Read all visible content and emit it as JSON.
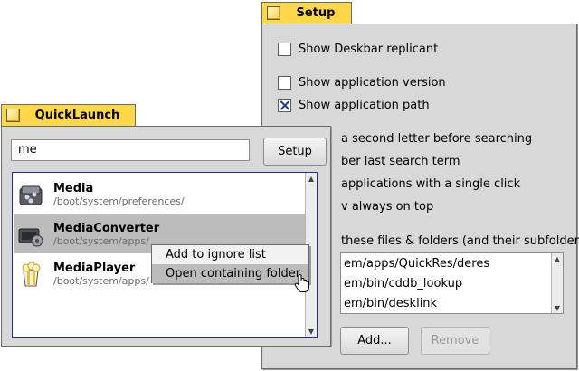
{
  "setup_window": {
    "title": "Setup",
    "options": [
      {
        "label": "Show Deskbar replicant",
        "checked": false
      },
      {
        "label": "Show application version",
        "checked": false
      },
      {
        "label": "Show application path",
        "checked": true
      },
      {
        "label": "a second letter before searching"
      },
      {
        "label": "ber last search term"
      },
      {
        "label": "applications with a single click"
      },
      {
        "label": "v always on top"
      }
    ],
    "ignore_label": "these files & folders (and their subfolders):",
    "ignore_list": [
      "em/apps/QuickRes/deres",
      "em/bin/cddb_lookup",
      "em/bin/desklink"
    ],
    "add_button": "Add...",
    "remove_button": "Remove"
  },
  "quicklaunch_window": {
    "title": "QuickLaunch",
    "search_value": "me",
    "setup_button": "Setup",
    "results": [
      {
        "name": "Media",
        "path": "/boot/system/preferences/",
        "icon": "media-prefs-icon"
      },
      {
        "name": "MediaConverter",
        "path": "/boot/system/apps/",
        "icon": "media-converter-icon"
      },
      {
        "name": "MediaPlayer",
        "path": "/boot/system/apps/",
        "icon": "media-player-icon"
      }
    ],
    "context_menu": [
      "Add to ignore list",
      "Open containing folder"
    ]
  },
  "colors": {
    "window_bg": "#d8d8d8",
    "tab_yellow": "#ffd84a",
    "list_border_focus": "#1f2f8f",
    "selection": "#bcbcbc",
    "checkmark": "#1a3c8c"
  },
  "icons": [
    "close-box-icon",
    "checkmark-icon",
    "media-prefs-icon",
    "media-converter-icon",
    "media-player-icon",
    "scroll-up-arrow-icon",
    "scroll-down-arrow-icon",
    "hand-cursor-icon"
  ]
}
